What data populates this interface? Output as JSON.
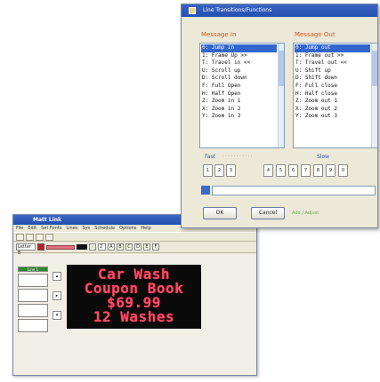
{
  "editor": {
    "title": "Matt Link",
    "menu": [
      "File",
      "Edit",
      "Set Fonts",
      "Lines",
      "Sys",
      "Schedule",
      "Options",
      "Help"
    ],
    "toolbar2": {
      "font_select": "Letter 8",
      "size_value": "2",
      "buttons": [
        "A",
        "B",
        "C",
        "D",
        "E",
        "F"
      ]
    },
    "active_line_label": "Line 1",
    "led_lines": [
      "Car Wash",
      "Coupon Book",
      "$69.99",
      "12 Washes"
    ],
    "colors": {
      "led_text": "#ff4a66",
      "led_bg": "#0a0a0a"
    }
  },
  "dialog": {
    "title": "Line Transitions/Functions",
    "move_in_label": "Message In",
    "move_out_label": "Message Out",
    "move_in_items": [
      "0: Jump in",
      "1: Frame Up >>",
      "T: Travel in <<",
      "U: Scroll up",
      "D: Scroll down",
      "F: Full Open",
      "H: Half Open",
      "Z: Zoom in 1",
      "X: Zoom in 2",
      "Y: Zoom in 3"
    ],
    "move_out_items": [
      "0: Jump out",
      "1: Frame out >>",
      "T: Travel out <<",
      "U: Shift up",
      "D: Shift down",
      "F: Full close",
      "H: Half close",
      "Z: Zoom out 1",
      "X: Zoom out 2",
      "Y: Zoom out 3"
    ],
    "fast_label": "Fast",
    "slow_label": "Slow",
    "speed_numbers": [
      "1",
      "2",
      "3",
      "4",
      "5",
      "6",
      "7",
      "8",
      "9",
      "0"
    ],
    "ok_label": "OK",
    "cancel_label": "Cancel",
    "link_label": "Add / Adjust",
    "colors": {
      "group_label": "#d35a18",
      "selected": "#3366cc"
    }
  }
}
